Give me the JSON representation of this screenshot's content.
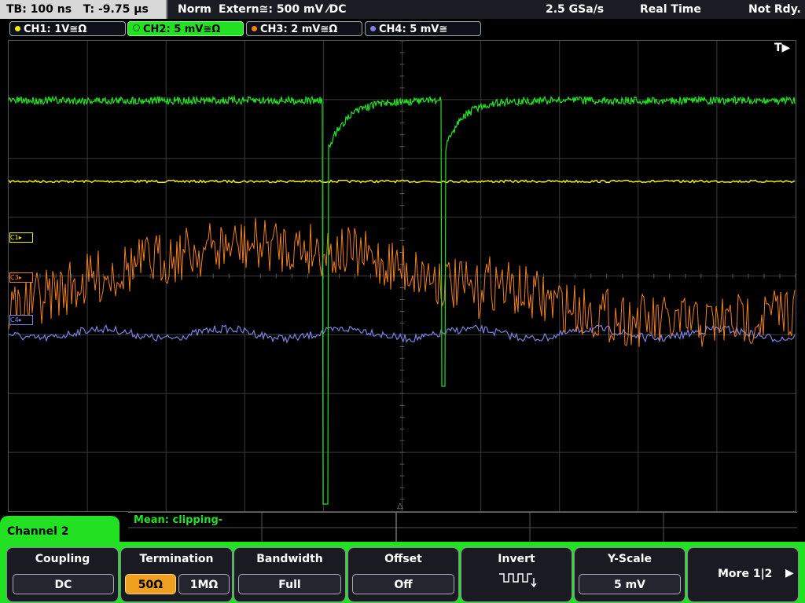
{
  "status": {
    "timebase": "TB: 100 ns",
    "trigger_time": "T: -9.75 µs",
    "mode": "Norm",
    "trigger_source": "Extern≅: 500 mV ⁄DC",
    "sample_rate": "2.5 GSa/s",
    "acq_mode": "Real Time",
    "state": "Not Rdy."
  },
  "channels": [
    {
      "label": "CH1: 1V≅Ω",
      "color": "#f0f000"
    },
    {
      "label": "CH2: 5 mV≅Ω",
      "color": "#22e022"
    },
    {
      "label": "CH3: 2 mV≅Ω",
      "color": "#f08020"
    },
    {
      "label": "CH4: 5 mV≅",
      "color": "#8080e0"
    }
  ],
  "markers": {
    "c1": "C1",
    "c3": "C3",
    "c4": "C4",
    "trigger": "T▶"
  },
  "measurement": {
    "text": "Mean: clipping-"
  },
  "menu": {
    "tab_label": "Channel 2",
    "coupling": {
      "title": "Coupling",
      "value": "DC"
    },
    "termination": {
      "title": "Termination",
      "opt1": "50Ω",
      "opt2": "1MΩ"
    },
    "bandwidth": {
      "title": "Bandwidth",
      "value": "Full"
    },
    "offset": {
      "title": "Offset",
      "value": "Off"
    },
    "invert": {
      "title": "Invert"
    },
    "yscale": {
      "title": "Y-Scale",
      "value": "5 mV"
    },
    "more": {
      "label": "More 1|2"
    }
  }
}
